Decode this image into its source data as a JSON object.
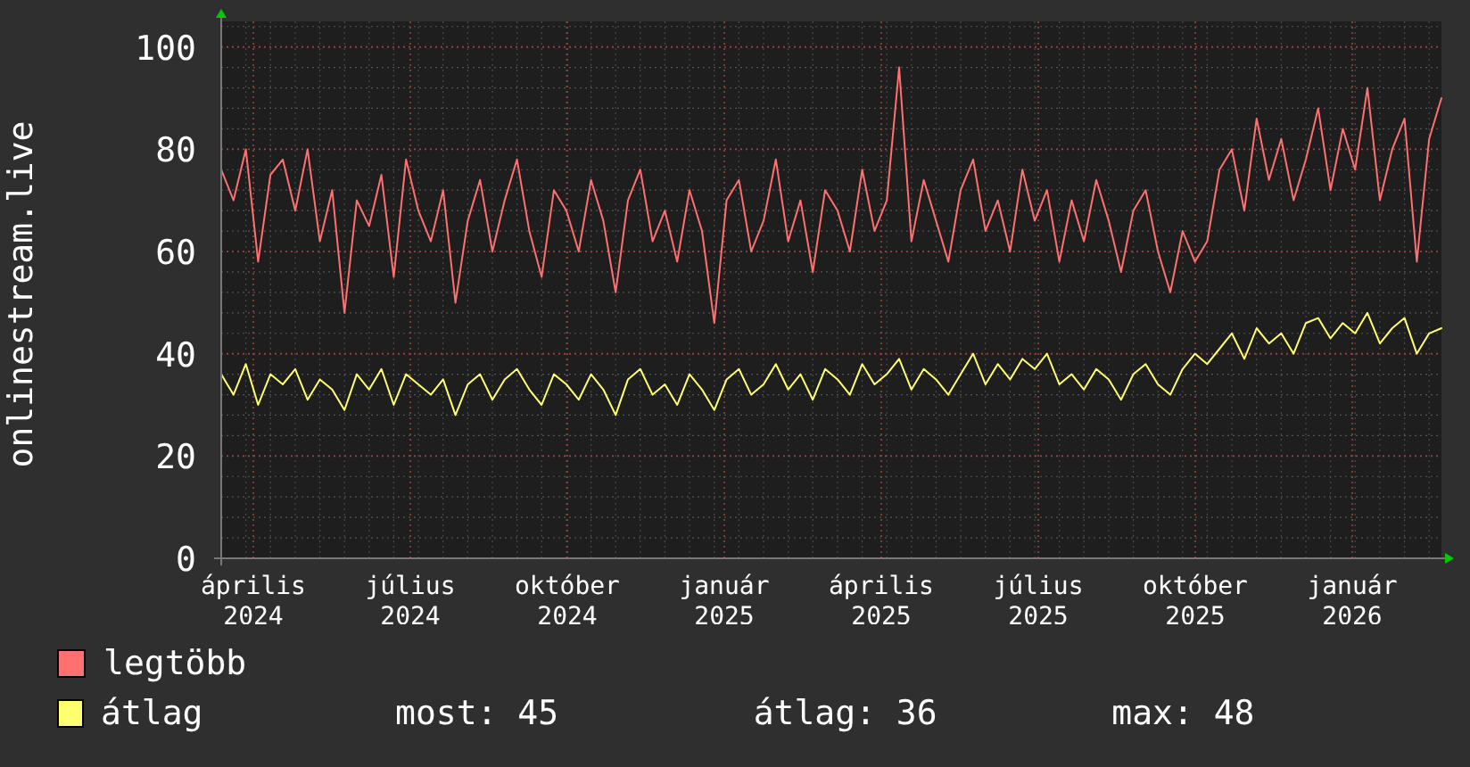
{
  "chart": {
    "chart_data": {
      "type": "line",
      "ylabel": "onlinestream.live",
      "ylim": [
        0,
        105
      ],
      "yticks": [
        0,
        20,
        40,
        60,
        80,
        100
      ],
      "grid": true,
      "series": [
        {
          "name": "legtöbb",
          "color": "#ff7070",
          "values": [
            76,
            70,
            80,
            58,
            75,
            78,
            68,
            80,
            62,
            72,
            48,
            70,
            65,
            75,
            55,
            78,
            68,
            62,
            72,
            50,
            66,
            74,
            60,
            70,
            78,
            64,
            55,
            72,
            68,
            60,
            74,
            66,
            52,
            70,
            76,
            62,
            68,
            58,
            72,
            64,
            46,
            70,
            74,
            60,
            66,
            78,
            62,
            70,
            56,
            72,
            68,
            60,
            76,
            64,
            70,
            96,
            62,
            74,
            66,
            58,
            72,
            78,
            64,
            70,
            60,
            76,
            66,
            72,
            58,
            70,
            62,
            74,
            66,
            56,
            68,
            72,
            60,
            52,
            64,
            58,
            62,
            76,
            80,
            68,
            86,
            74,
            82,
            70,
            78,
            88,
            72,
            84,
            76,
            92,
            70,
            80,
            86,
            58,
            82,
            90
          ]
        },
        {
          "name": "átlag",
          "color": "#ffff70",
          "values": [
            36,
            32,
            38,
            30,
            36,
            34,
            37,
            31,
            35,
            33,
            29,
            36,
            33,
            37,
            30,
            36,
            34,
            32,
            35,
            28,
            34,
            36,
            31,
            35,
            37,
            33,
            30,
            36,
            34,
            31,
            36,
            33,
            28,
            35,
            37,
            32,
            34,
            30,
            36,
            33,
            29,
            35,
            37,
            32,
            34,
            38,
            33,
            36,
            31,
            37,
            35,
            32,
            38,
            34,
            36,
            39,
            33,
            37,
            35,
            32,
            36,
            40,
            34,
            38,
            35,
            39,
            37,
            40,
            34,
            36,
            33,
            37,
            35,
            31,
            36,
            38,
            34,
            32,
            37,
            40,
            38,
            41,
            44,
            39,
            45,
            42,
            44,
            40,
            46,
            47,
            43,
            46,
            44,
            48,
            42,
            45,
            47,
            40,
            44,
            45
          ]
        }
      ]
    },
    "x_labels": [
      "április 2024",
      "július 2024",
      "október 2024",
      "január 2025",
      "április 2025",
      "július 2025",
      "október 2025",
      "január 2026"
    ],
    "legend_stats": [
      "most: 45",
      "átlag: 36",
      "max: 48"
    ]
  }
}
